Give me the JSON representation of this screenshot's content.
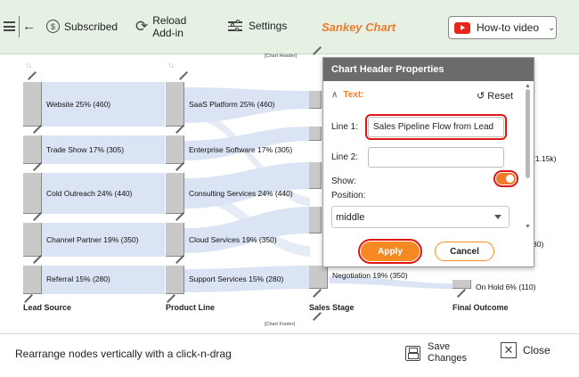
{
  "toolbar": {
    "subscribed_label": "Subscribed",
    "reload_line1": "Reload",
    "reload_line2": "Add-in",
    "settings_label": "Settings",
    "app_title": "Sankey Chart",
    "howto_label": "How-to video"
  },
  "chart": {
    "header_tag": "[Chart Header]",
    "footer_tag": "[Chart Footer]",
    "columns": [
      {
        "label": "Lead Source",
        "nodes": [
          "Website 25% (460)",
          "Trade Show 17% (305)",
          "Cold Outreach 24% (440)",
          "Channel Partner 19% (350)",
          "Referral 15% (280)"
        ]
      },
      {
        "label": "Product Line",
        "nodes": [
          "SaaS Platform 25% (460)",
          "Enterprise Software 17% (305)",
          "Consulting Services 24% (440)",
          "Cloud Services 19% (350)",
          "Support Services 15% (280)"
        ]
      },
      {
        "label": "Sales Stage",
        "nodes": [
          "Negotiation 19% (350)"
        ]
      },
      {
        "label": "Final Outcome",
        "nodes": [
          "On Hold 6% (110)"
        ]
      }
    ],
    "partial_labels": [
      "(1.15k)",
      "80)"
    ]
  },
  "dialog": {
    "title": "Chart Header Properties",
    "section_label": "Text:",
    "reset_label": "Reset",
    "line1_label": "Line 1:",
    "line1_value": "Sales Pipeline Flow from Lead",
    "line2_label": "Line 2:",
    "line2_value": "",
    "show_label": "Show:",
    "show_on": true,
    "position_label": "Position:",
    "position_value": "middle",
    "apply_label": "Apply",
    "cancel_label": "Cancel"
  },
  "bottom": {
    "hint": "Rearrange nodes vertically with a click-n-drag",
    "save_line1": "Save",
    "save_line2": "Changes",
    "close_label": "Close"
  },
  "colors": {
    "accent": "#f07a2a",
    "toolbar_bg": "#e4f1e3",
    "highlight": "#e01515",
    "flow": "#dbe4f4"
  }
}
